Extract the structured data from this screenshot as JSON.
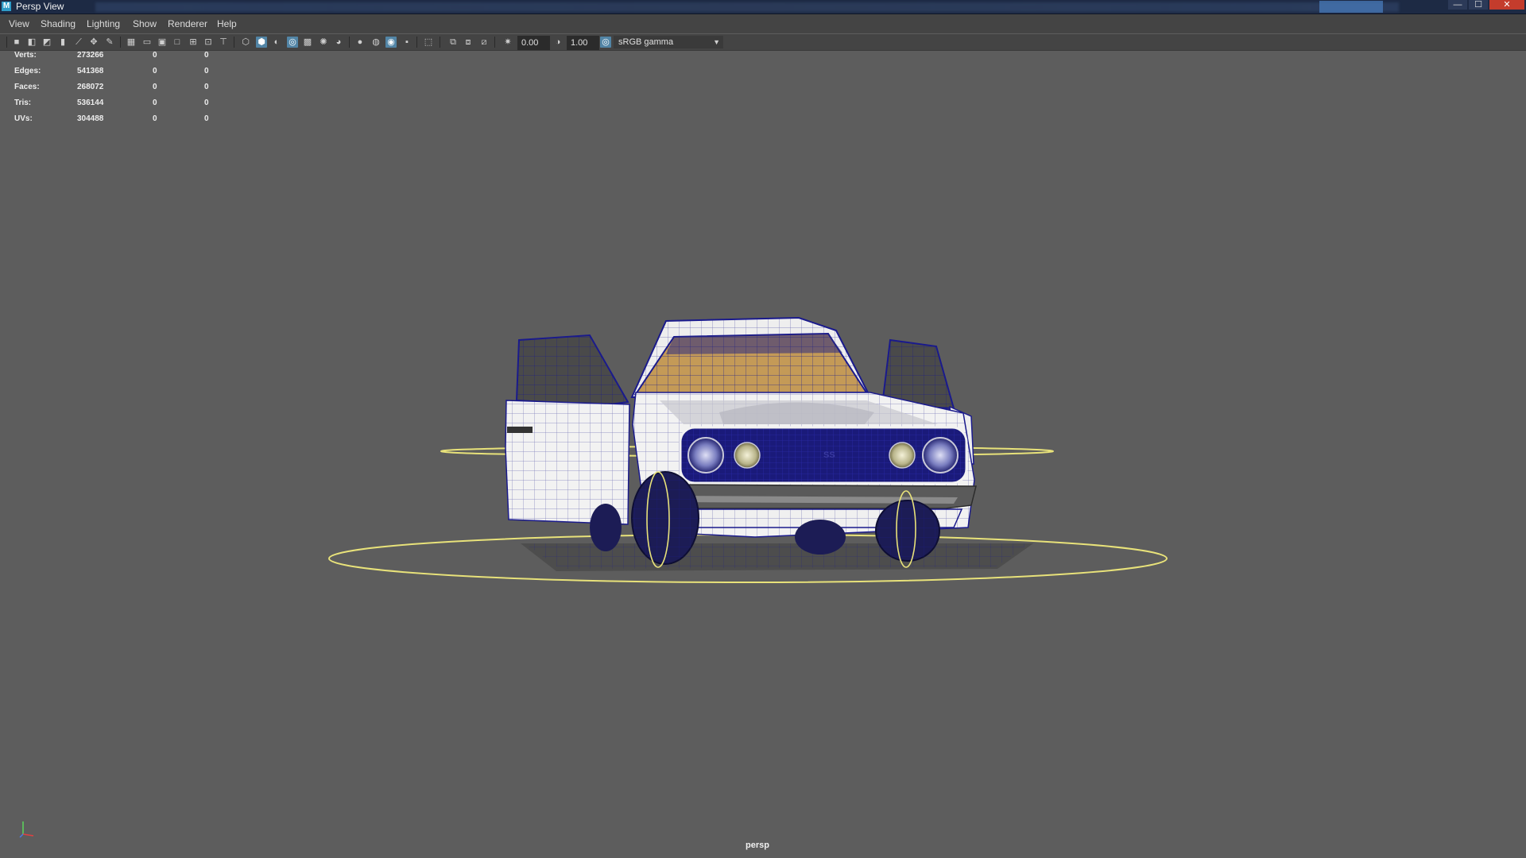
{
  "window": {
    "title": "Persp View",
    "app_logo": "M",
    "controls": {
      "minimize": "—",
      "maximize": "☐",
      "close": "✕"
    }
  },
  "menu": [
    "View",
    "Shading",
    "Lighting",
    "Show",
    "Renderer",
    "Help"
  ],
  "toolbar": {
    "exposure": "0.00",
    "gamma": "1.00",
    "color_space": "sRGB gamma",
    "active_color": "#5285a6"
  },
  "hud": {
    "rows": [
      {
        "label": "Verts:",
        "v1": "273266",
        "v2": "0",
        "v3": "0"
      },
      {
        "label": "Edges:",
        "v1": "541368",
        "v2": "0",
        "v3": "0"
      },
      {
        "label": "Faces:",
        "v1": "268072",
        "v2": "0",
        "v3": "0"
      },
      {
        "label": "Tris:",
        "v1": "536144",
        "v2": "0",
        "v3": "0"
      },
      {
        "label": "UVs:",
        "v1": "304488",
        "v2": "0",
        "v3": "0"
      }
    ]
  },
  "viewport": {
    "camera": "persp",
    "background": "#5d5d5d",
    "wireframe_color": "#1a1a8c",
    "selection_color": "#e8e27a",
    "grille_badge": "SS"
  }
}
